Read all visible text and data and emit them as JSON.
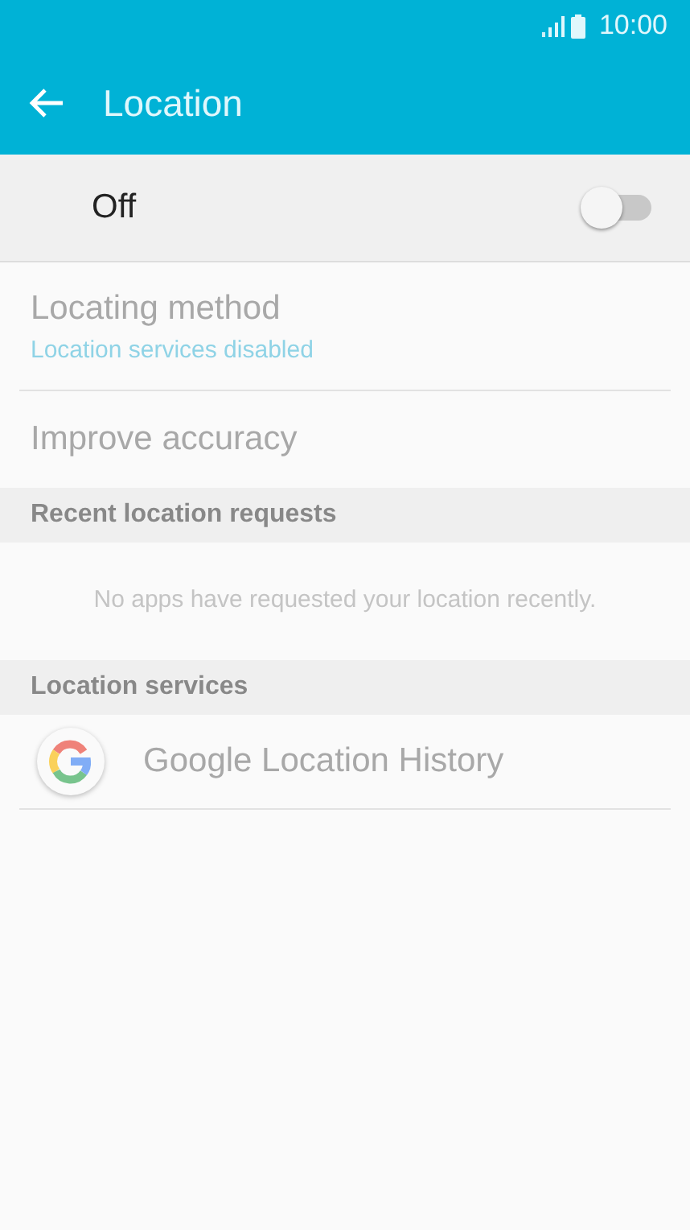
{
  "status_bar": {
    "time": "10:00"
  },
  "app_bar": {
    "title": "Location"
  },
  "master_switch": {
    "label": "Off",
    "on": false
  },
  "items": [
    {
      "title": "Locating method",
      "summary": "Location services disabled",
      "disabled": true
    },
    {
      "title": "Improve accuracy",
      "disabled": true
    }
  ],
  "sections": [
    {
      "header": "Recent location requests",
      "empty_text": "No apps have requested your location recently."
    },
    {
      "header": "Location services",
      "items": [
        {
          "title": "Google Location History",
          "disabled": true
        }
      ]
    }
  ]
}
